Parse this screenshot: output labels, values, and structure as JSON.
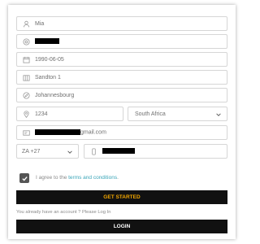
{
  "form": {
    "first_name": "Mia",
    "date_of_birth": "1990-06-05",
    "address_line": "Sandton 1",
    "city": "Johannesbourg",
    "postal_code": "1234",
    "country": "South Africa",
    "email_suffix": "gmail.com",
    "dial_code": "ZA +27"
  },
  "terms": {
    "prefix": "I agree to the ",
    "link": "terms and conditions",
    "suffix": "."
  },
  "buttons": {
    "get_started": "GET STARTED",
    "login": "LOGIN"
  },
  "already_text": "You already have an account ? Please Log In",
  "colors": {
    "accent": "#f0a500",
    "button_bg": "#111111",
    "link": "#3aa5b8",
    "checkbox": "#555555",
    "border": "#d6d6d6"
  },
  "icons": [
    "user-icon",
    "at-icon",
    "calendar-icon",
    "building-icon",
    "compass-icon",
    "location-pin-icon",
    "chevron-down-icon",
    "id-card-icon",
    "phone-icon",
    "check-icon"
  ]
}
